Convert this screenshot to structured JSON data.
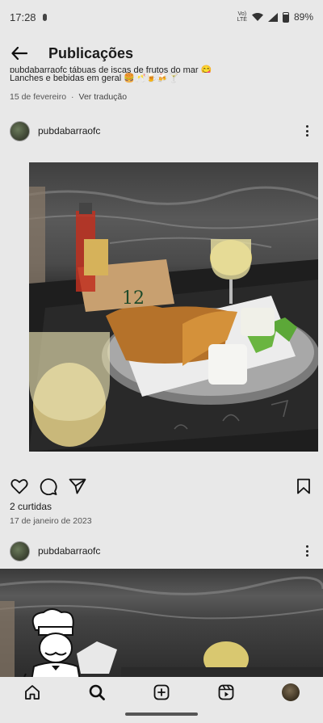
{
  "status_bar": {
    "time": "17:28",
    "network": "VoLTE",
    "network_lines": [
      "Vo)",
      "LTE"
    ],
    "battery": "89%"
  },
  "header": {
    "title": "Publicações"
  },
  "previous_post": {
    "caption_line1": "pubdabarraofc tábuas de iscas de frutos do mar 😋",
    "caption_line2": "Lanches e bebidas em geral 🍔🥂🍺🍻🍸",
    "date": "15 de fevereiro",
    "separator": "·",
    "translate_label": "Ver tradução"
  },
  "post": {
    "username": "pubdabarraofc",
    "photo_label": "12",
    "likes": "2 curtidas",
    "date": "17 de janeiro de 2023"
  },
  "next_post": {
    "username": "pubdabarraofc"
  },
  "icons": {
    "back": "arrow-left-icon",
    "more": "more-vertical-icon",
    "like": "heart-icon",
    "comment": "comment-icon",
    "share": "send-icon",
    "save": "bookmark-icon",
    "home": "home-icon",
    "search": "search-icon",
    "create": "plus-square-icon",
    "reels": "reels-icon",
    "logo": "chef-logo-icon"
  }
}
